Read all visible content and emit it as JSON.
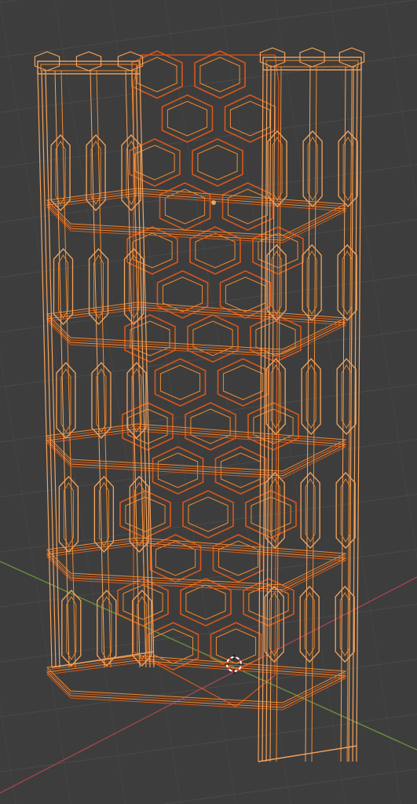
{
  "viewport": {
    "background": "#3d3d3d",
    "grid_color": "#4a4a4a",
    "axis_x_color": "#a34450",
    "axis_y_color": "#6a8f3a",
    "wire_selected_color": "#f08a2c",
    "wire_inner_color": "#d9571a",
    "wire_active_color": "#f5a25a",
    "cursor_color_a": "#c8404a",
    "cursor_color_b": "#ffffff"
  },
  "scene": {
    "object": "hexagonal-shelf-wireframe",
    "shelf_count": 5,
    "selected": true
  },
  "icons": {
    "origin": "origin-dot-icon",
    "cursor": "3d-cursor-icon"
  }
}
